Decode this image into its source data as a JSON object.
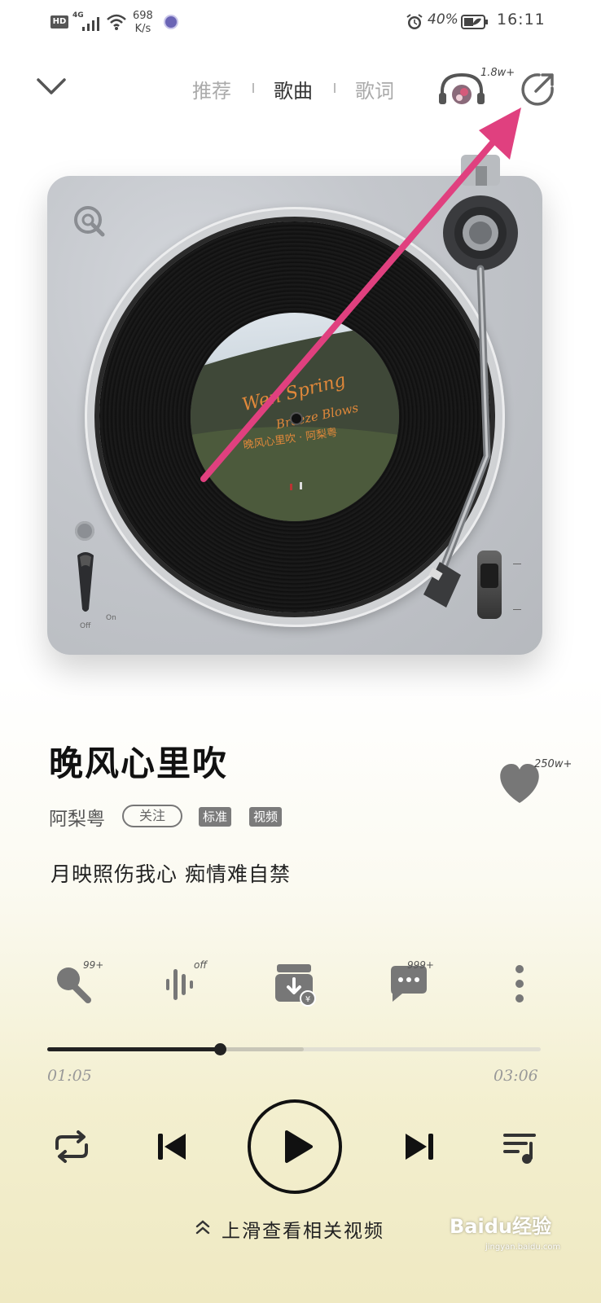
{
  "status_bar": {
    "hd": "HD",
    "network": "4G",
    "speed_value": "698",
    "speed_unit": "K/s",
    "battery_percent": "40%",
    "time": "16:11"
  },
  "header": {
    "tabs": [
      {
        "label": "推荐",
        "active": false
      },
      {
        "label": "歌曲",
        "active": true
      },
      {
        "label": "歌词",
        "active": false
      }
    ],
    "listen_count": "1.8w+"
  },
  "turntable": {
    "album_text_1": "Wen Spring",
    "album_text_2": "Breeze Blows",
    "album_text_3": "晚风心里吹 · 阿梨粤",
    "switch_off": "Off",
    "switch_on": "On"
  },
  "song": {
    "title": "晚风心里吹",
    "artist": "阿梨粤",
    "follow_label": "关注",
    "badges": [
      "标准",
      "视频"
    ],
    "like_count": "250w+",
    "current_lyric": "月映照伤我心 痴情难自禁"
  },
  "actions": [
    {
      "icon": "microphone-icon",
      "badge": "99+"
    },
    {
      "icon": "sound-effect-icon",
      "badge": "off"
    },
    {
      "icon": "download-icon",
      "badge": ""
    },
    {
      "icon": "comment-icon",
      "badge": "999+"
    },
    {
      "icon": "more-icon",
      "badge": ""
    }
  ],
  "progress": {
    "current": "01:05",
    "total": "03:06",
    "played_fraction": 0.35,
    "buffered_fraction": 0.52
  },
  "footer": {
    "swipe_hint": "上滑查看相关视频",
    "watermark": "Baidu经验",
    "watermark_sub": "jingyan.baidu.com"
  },
  "colors": {
    "annotation_arrow": "#e0407f",
    "accent": "#111111"
  }
}
